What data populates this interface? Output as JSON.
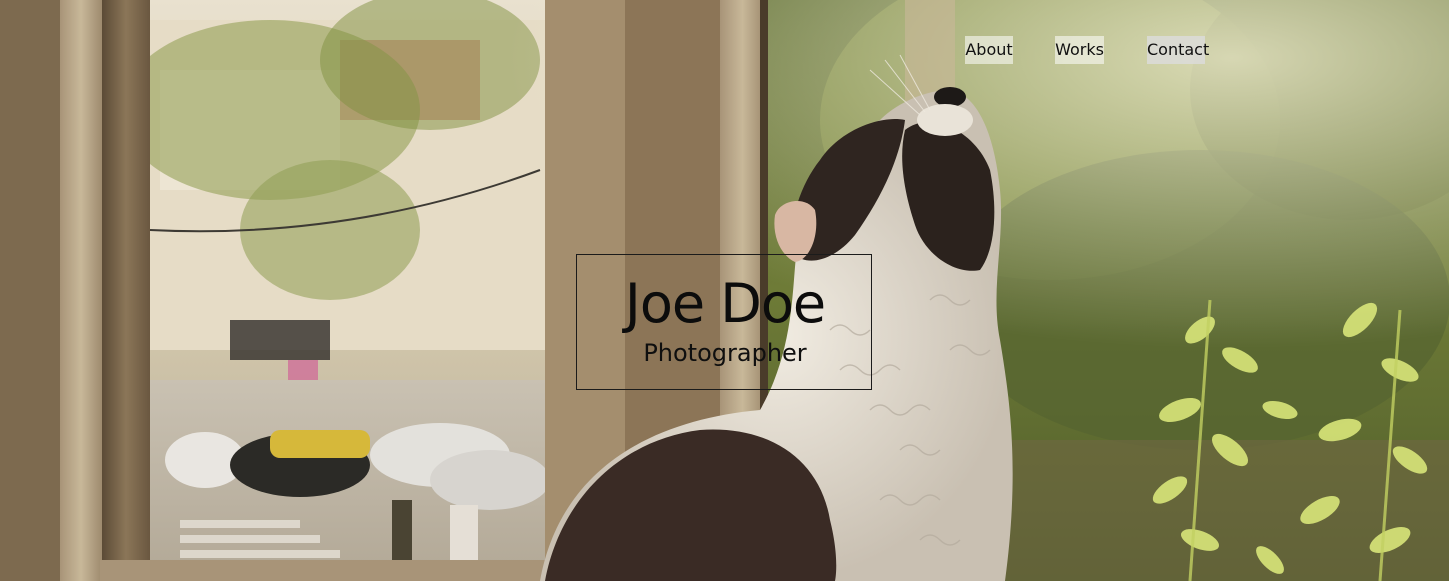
{
  "nav": {
    "items": [
      {
        "label": "About"
      },
      {
        "label": "Works"
      },
      {
        "label": "Contact"
      }
    ]
  },
  "hero": {
    "title": "Joe Doe",
    "subtitle": "Photographer",
    "background_image": "dog-looking-out-window-photo"
  },
  "colors": {
    "text": "#111111",
    "border": "#1b1b1b",
    "nav_highlight": "#ffffff"
  }
}
